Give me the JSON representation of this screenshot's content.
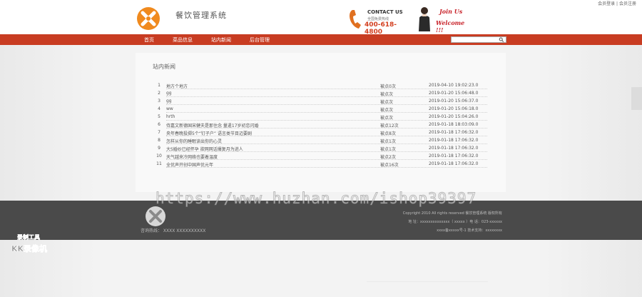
{
  "top_links": {
    "login": "会员登录",
    "sep": "|",
    "register": "会员注册"
  },
  "site": {
    "name": "餐饮管理系统",
    "logo_icon": "orange-x-logo-icon"
  },
  "contact": {
    "title": "CONTACT US",
    "sub": "全国免费热线",
    "phone": "400-618-4800"
  },
  "join": {
    "line1": "Join Us",
    "line2": "Welcome !!!"
  },
  "nav": {
    "items": [
      {
        "label": "首页"
      },
      {
        "label": "菜品信息"
      },
      {
        "label": "站内新闻"
      },
      {
        "label": "后台管理"
      }
    ],
    "search_value": "",
    "search_icon": "search-icon"
  },
  "news": {
    "title": "站内新闻",
    "rows": [
      {
        "num": "1",
        "title": "地方个地方",
        "clicks": "被点0次",
        "date": "2019-04-10 19:02:23.0"
      },
      {
        "num": "2",
        "title": "gg",
        "clicks": "被点次",
        "date": "2019-01-20 15:06:48.0"
      },
      {
        "num": "3",
        "title": "gg",
        "clicks": "被点次",
        "date": "2019-01-20 15:06:37.0"
      },
      {
        "num": "4",
        "title": "ww",
        "clicks": "被点次",
        "date": "2019-01-20 15:06:18.0"
      },
      {
        "num": "5",
        "title": "hrth",
        "clicks": "被点次",
        "date": "2019-01-20 15:04:26.0"
      },
      {
        "num": "6",
        "title": "侍嘉文新德国宋健夫是那住念 量遣17岁初恋闪婚",
        "clicks": "被点12次",
        "date": "2019-01-18 18:03:09.0"
      },
      {
        "num": "7",
        "title": "央年春晚投掷5个“钉子户” 语言类节目迈要剧",
        "clicks": "被点8次",
        "date": "2019-01-18 17:06:32.0"
      },
      {
        "num": "8",
        "title": "怎样从你的睡眠读出你的心灵",
        "clicks": "被点1次",
        "date": "2019-01-18 17:06:32.0"
      },
      {
        "num": "9",
        "title": "大S婚纱已经怀孕 欲网网话爆复月为进人",
        "clicks": "被点1次",
        "date": "2019-01-18 17:06:32.0"
      },
      {
        "num": "10",
        "title": "天气越来冷网络也要着温度",
        "clicks": "被点2次",
        "date": "2019-01-18 17:06:32.0"
      },
      {
        "num": "11",
        "title": "全优声开创中国声优元年",
        "clicks": "被点16次",
        "date": "2019-01-18 17:06:32.0"
      }
    ]
  },
  "footer": {
    "hotline": "咨询热线：  XXXX  XXXXXXXXXX",
    "copyright": "Copyright 2010 All rights reserved 餐饮管理系统 版权所有",
    "address": "地   址：xxxxxxxxxxxxxx（ xxxxx ）电    话：023-xxxxxx",
    "icp": "xxxx备xxxxx号-1 技术支持：xxxxxxxx"
  },
  "watermark": "https://www.huzhan.com/ishop39397",
  "recorder": {
    "line1": "录制工具",
    "line2": "KK录像机"
  },
  "colors": {
    "nav_bg": "#c83c22",
    "brand_orange": "#f08a1e",
    "phone_red": "#d33f1f",
    "footer_bg": "#4a4a4a"
  }
}
